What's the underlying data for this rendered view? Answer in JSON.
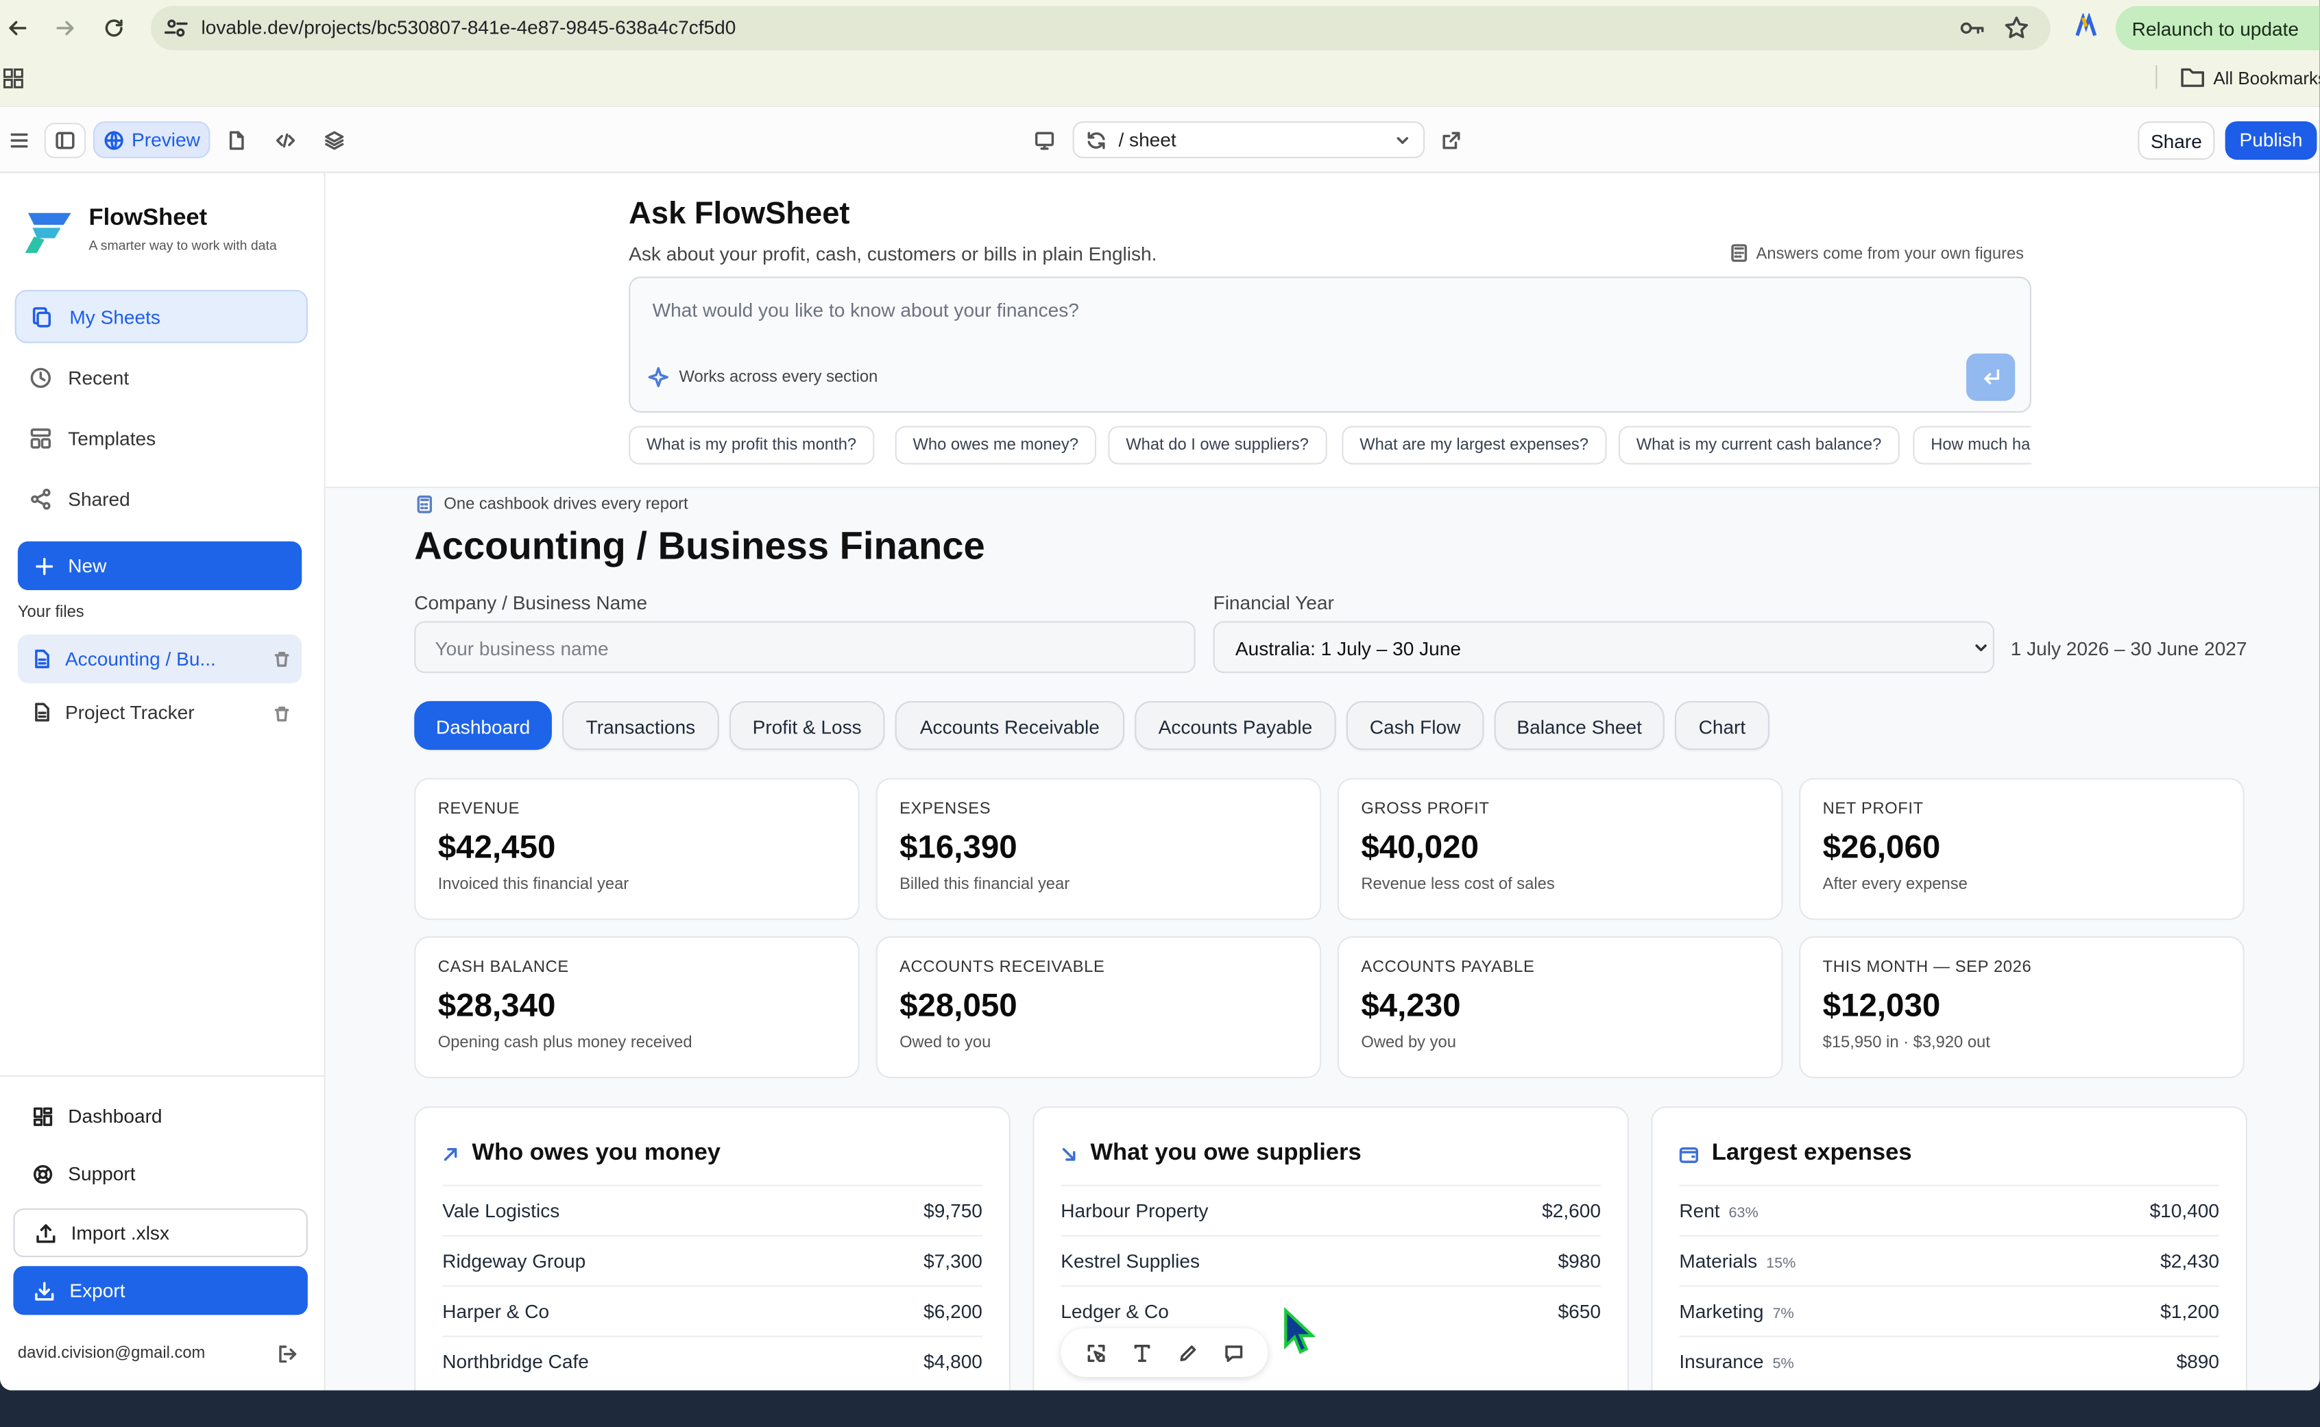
{
  "browser": {
    "url": "lovable.dev/projects/bc530807-841e-4e87-9845-638a4c7cf5d0",
    "relaunch_label": "Relaunch to update",
    "bookmarks_label": "All Bookmarks"
  },
  "editor": {
    "preview_label": "Preview",
    "route": "/ sheet",
    "share_label": "Share",
    "publish_label": "Publish"
  },
  "sidebar": {
    "brand_name": "FlowSheet",
    "brand_tagline": "A smarter way to work with data",
    "nav": [
      {
        "label": "My Sheets",
        "icon": "copy-icon"
      },
      {
        "label": "Recent",
        "icon": "clock-icon"
      },
      {
        "label": "Templates",
        "icon": "layout-icon"
      },
      {
        "label": "Shared",
        "icon": "share-icon"
      }
    ],
    "new_label": "New",
    "files_heading": "Your files",
    "files": [
      {
        "label": "Accounting / Bu..."
      },
      {
        "label": "Project Tracker"
      }
    ],
    "bottom": {
      "dashboard_label": "Dashboard",
      "support_label": "Support",
      "import_label": "Import .xlsx",
      "export_label": "Export",
      "user_email": "david.civision@gmail.com"
    }
  },
  "ask": {
    "title": "Ask FlowSheet",
    "subtitle": "Ask about your profit, cash, customers or bills in plain English.",
    "note": "Answers come from your own figures",
    "placeholder": "What would you like to know about your finances?",
    "hint": "Works across every section",
    "chips": [
      "What is my profit this month?",
      "Who owes me money?",
      "What do I owe suppliers?",
      "What are my largest expenses?",
      "What is my current cash balance?",
      "How much ha"
    ]
  },
  "sheet": {
    "banner": "One cashbook drives every report",
    "title": "Accounting / Business Finance",
    "company_label": "Company / Business Name",
    "company_placeholder": "Your business name",
    "fy_label": "Financial Year",
    "fy_value": "Australia: 1 July – 30 June",
    "fy_range": "1 July 2026 – 30 June 2027",
    "tabs": [
      "Dashboard",
      "Transactions",
      "Profit & Loss",
      "Accounts Receivable",
      "Accounts Payable",
      "Cash Flow",
      "Balance Sheet",
      "Chart"
    ],
    "active_tab": "Dashboard"
  },
  "kpis": [
    {
      "label": "REVENUE",
      "value": "$42,450",
      "sub": "Invoiced this financial year"
    },
    {
      "label": "EXPENSES",
      "value": "$16,390",
      "sub": "Billed this financial year"
    },
    {
      "label": "GROSS PROFIT",
      "value": "$40,020",
      "sub": "Revenue less cost of sales"
    },
    {
      "label": "NET PROFIT",
      "value": "$26,060",
      "sub": "After every expense"
    },
    {
      "label": "CASH BALANCE",
      "value": "$28,340",
      "sub": "Opening cash plus money received"
    },
    {
      "label": "ACCOUNTS RECEIVABLE",
      "value": "$28,050",
      "sub": "Owed to you"
    },
    {
      "label": "ACCOUNTS PAYABLE",
      "value": "$4,230",
      "sub": "Owed by you"
    },
    {
      "label": "THIS MONTH — SEP 2026",
      "value": "$12,030",
      "sub": "$15,950 in · $3,920 out"
    }
  ],
  "panels": {
    "receivable": {
      "title": "Who owes you money",
      "rows": [
        {
          "name": "Vale Logistics",
          "amount": "$9,750"
        },
        {
          "name": "Ridgeway Group",
          "amount": "$7,300"
        },
        {
          "name": "Harper & Co",
          "amount": "$6,200"
        },
        {
          "name": "Northbridge Cafe",
          "amount": "$4,800"
        }
      ]
    },
    "payable": {
      "title": "What you owe suppliers",
      "rows": [
        {
          "name": "Harbour Property",
          "amount": "$2,600"
        },
        {
          "name": "Kestrel Supplies",
          "amount": "$980"
        },
        {
          "name": "Ledger & Co",
          "amount": "$650"
        }
      ]
    },
    "expenses": {
      "title": "Largest expenses",
      "rows": [
        {
          "name": "Rent",
          "pct": "63%",
          "amount": "$10,400"
        },
        {
          "name": "Materials",
          "pct": "15%",
          "amount": "$2,430"
        },
        {
          "name": "Marketing",
          "pct": "7%",
          "amount": "$1,200"
        },
        {
          "name": "Insurance",
          "pct": "5%",
          "amount": "$890"
        }
      ]
    }
  },
  "colors": {
    "accent": "#1d64e8",
    "chrome_bg": "#f2f5e6",
    "relaunch_bg": "#c5edc0"
  }
}
